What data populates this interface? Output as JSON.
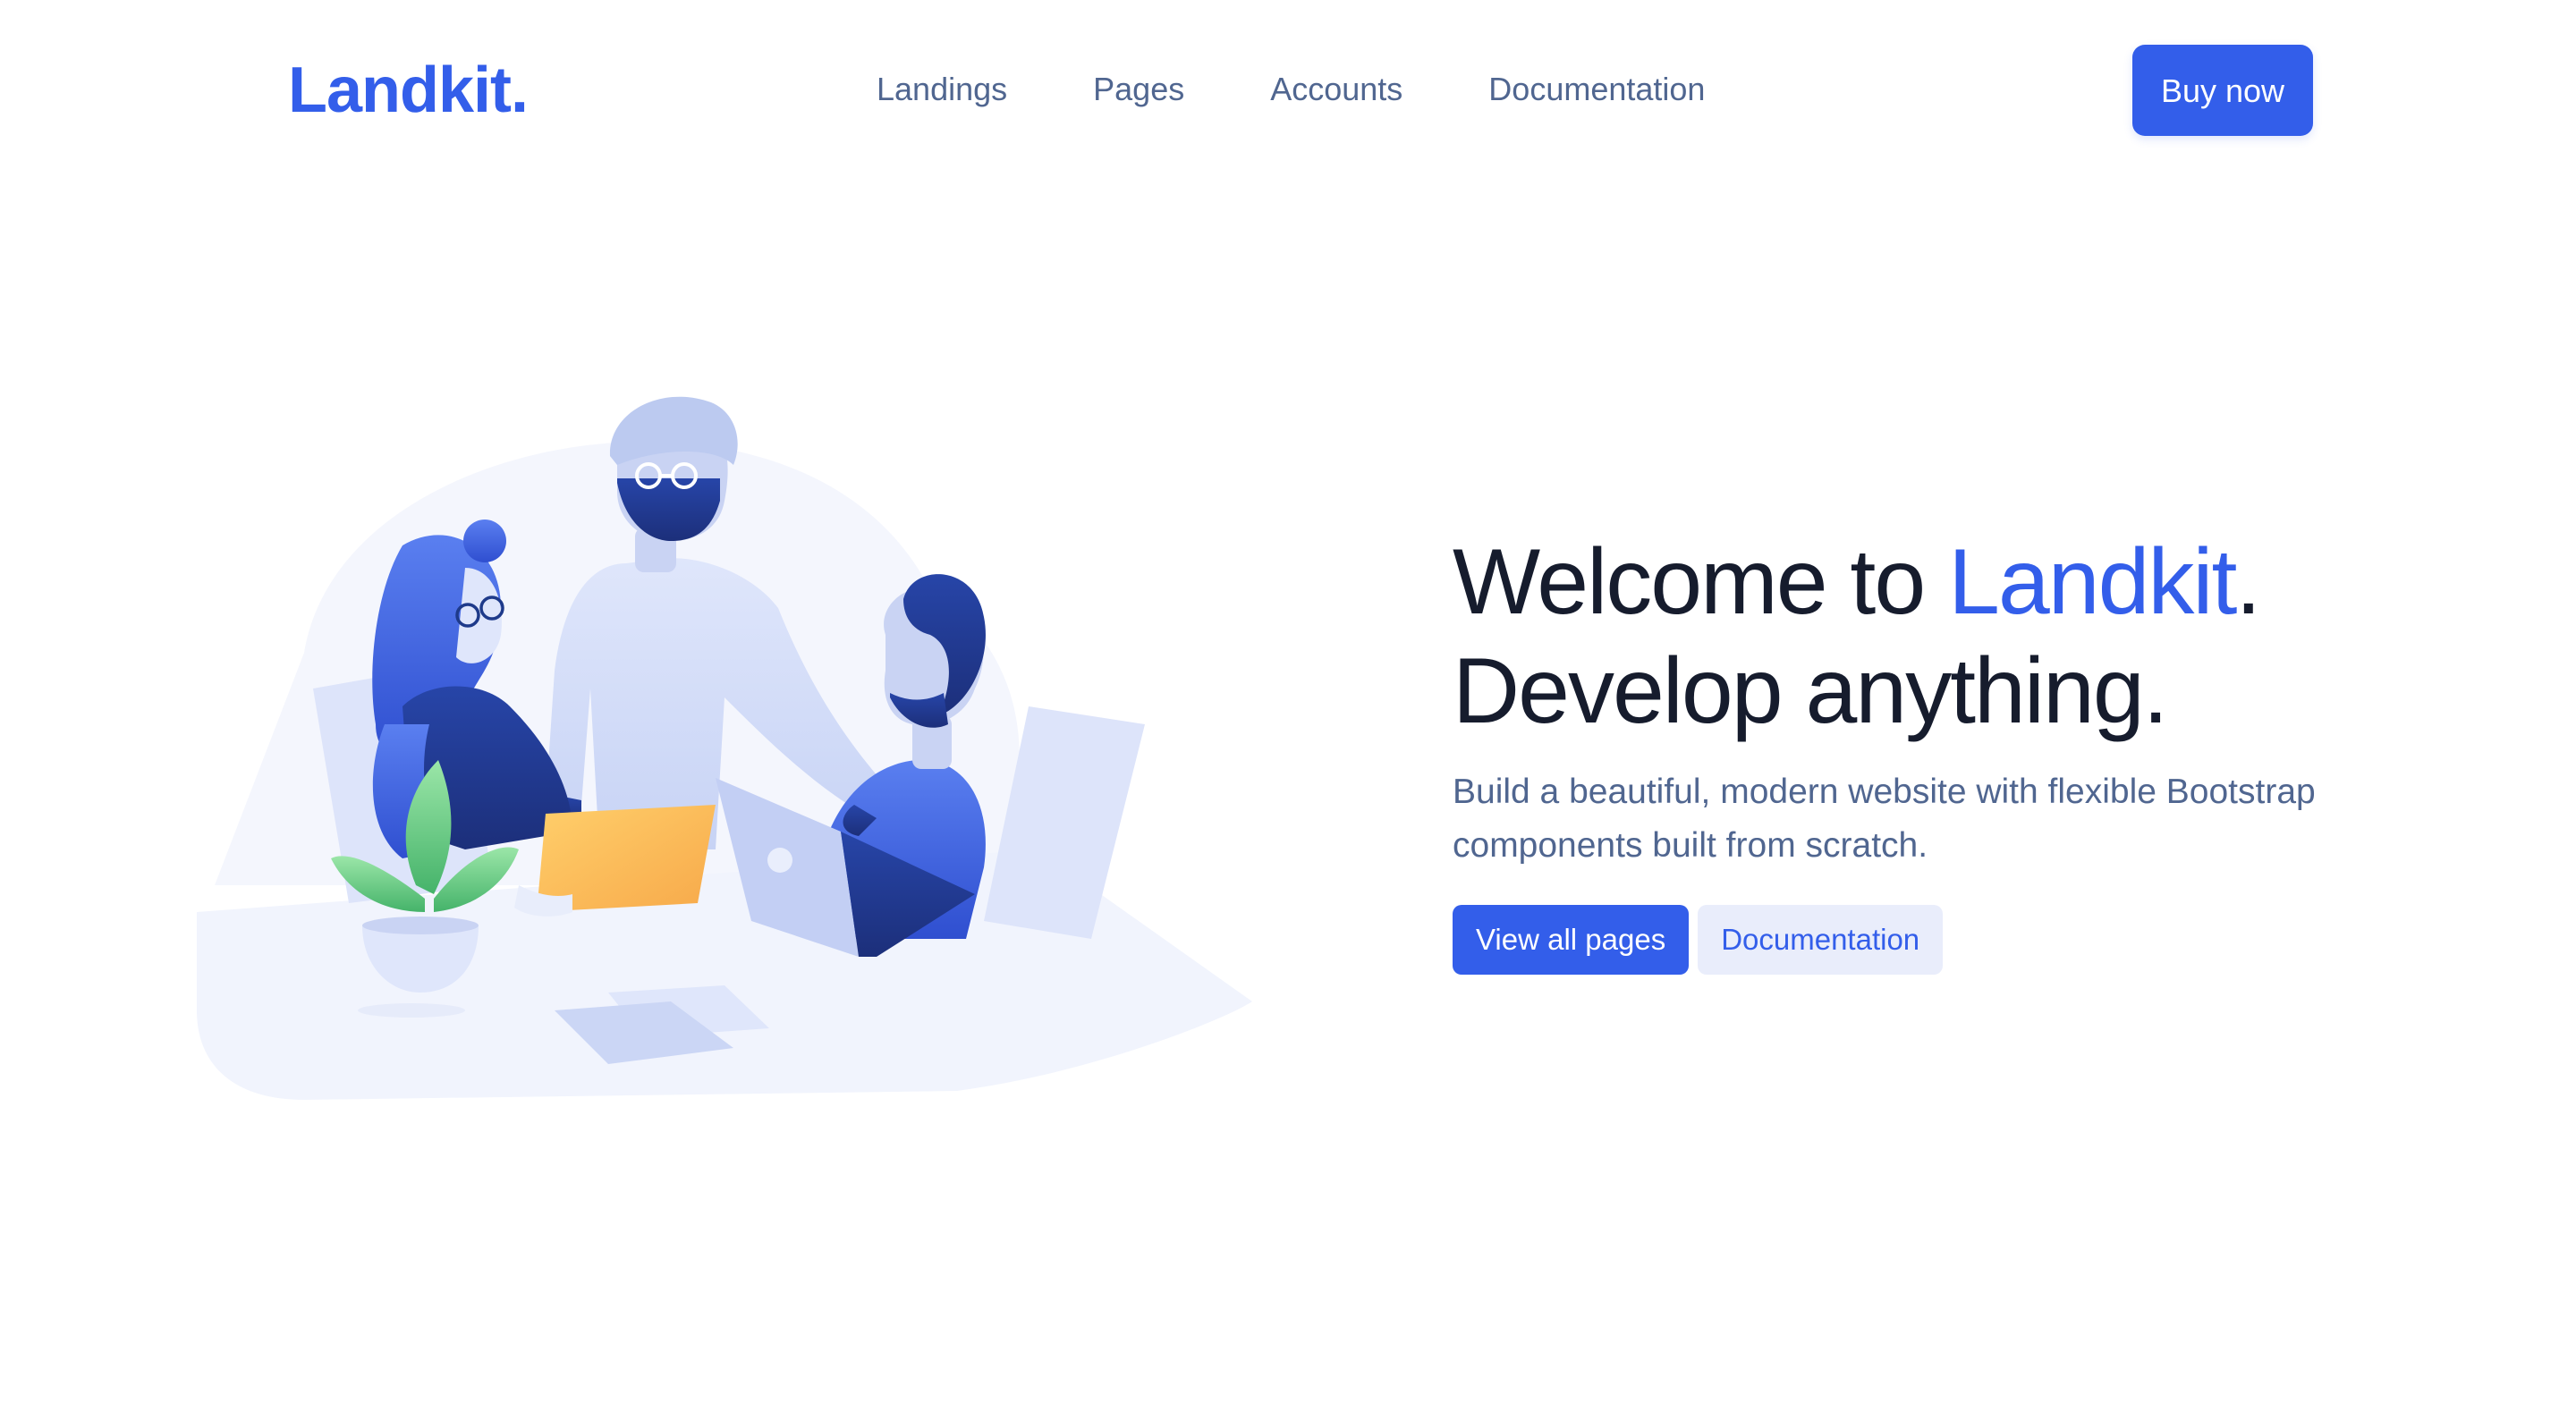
{
  "navbar": {
    "brand": "Landkit.",
    "links": [
      "Landings",
      "Pages",
      "Accounts",
      "Documentation"
    ],
    "cta_label": "Buy now"
  },
  "hero": {
    "title_prefix": "Welcome to ",
    "title_accent": "Landkit",
    "title_suffix": ".",
    "title_line2": "Develop anything.",
    "lead": "Build a beautiful, modern website with flexible Bootstrap components built from scratch.",
    "primary_button": "View all pages",
    "secondary_button": "Documentation"
  },
  "colors": {
    "primary": "#335eea",
    "heading": "#161c2d",
    "body_text": "#506690",
    "soft_button_bg": "#e9edfb"
  }
}
